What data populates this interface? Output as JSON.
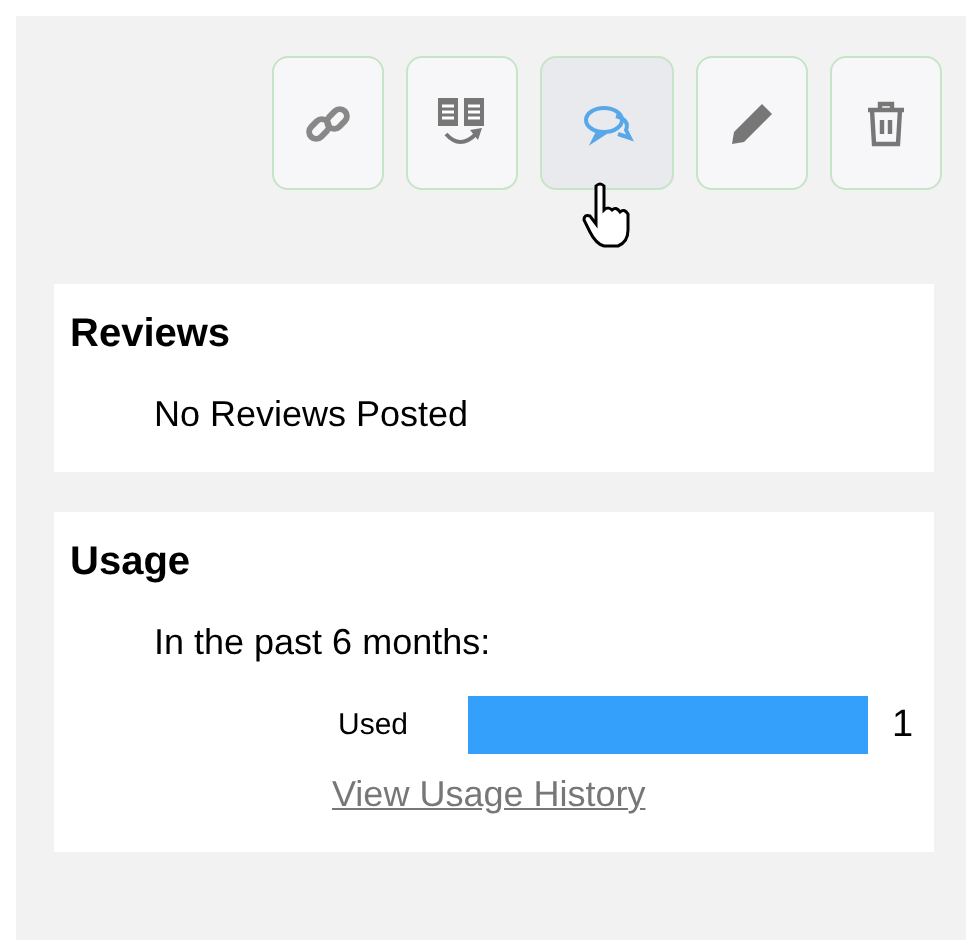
{
  "toolbar": [
    {
      "kind": "link",
      "selected": false
    },
    {
      "kind": "copy",
      "selected": false
    },
    {
      "kind": "comments",
      "selected": true
    },
    {
      "kind": "edit",
      "selected": false
    },
    {
      "kind": "delete",
      "selected": false
    }
  ],
  "reviews": {
    "title": "Reviews",
    "message": "No Reviews Posted"
  },
  "usage": {
    "title": "Usage",
    "period": "In the past 6 months:",
    "bar": {
      "label": "Used",
      "level": 1,
      "reading": "1"
    },
    "link": "View Usage History"
  }
}
